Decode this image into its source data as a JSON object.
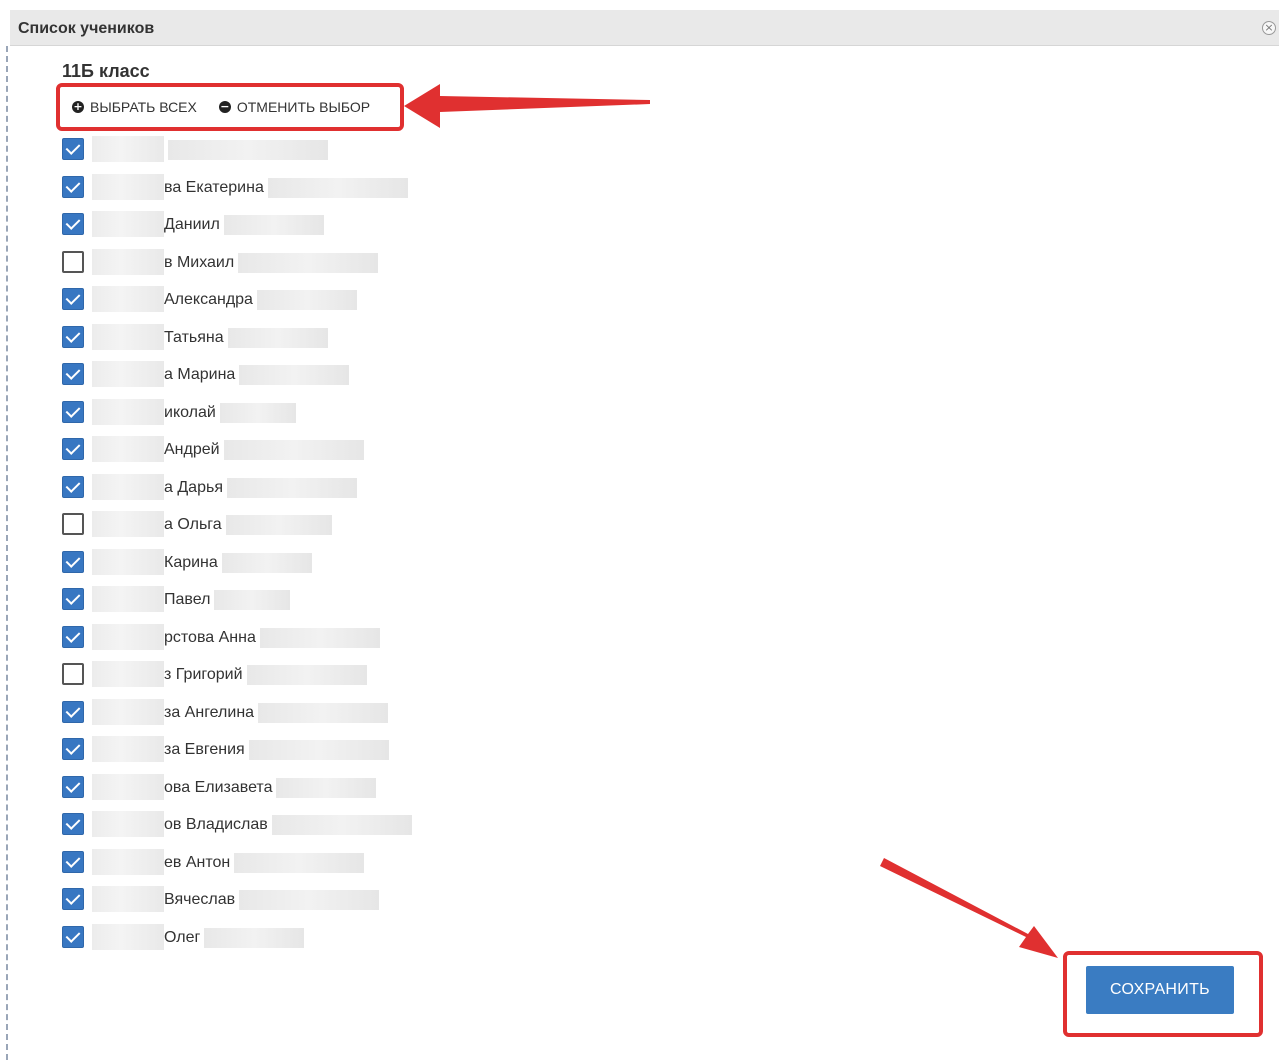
{
  "dialog": {
    "title": "Список учеников",
    "close_symbol": "×"
  },
  "class_name": "11Б класс",
  "actions": {
    "select_all": "ВЫБРАТЬ ВСЕХ",
    "select_all_icon": "plus-circle-icon",
    "deselect": "ОТМЕНИТЬ ВЫБОР",
    "deselect_icon": "minus-circle-icon"
  },
  "students": [
    {
      "name": "",
      "checked": true
    },
    {
      "name": "ва Екатерина",
      "checked": true
    },
    {
      "name": "Даниил",
      "checked": true
    },
    {
      "name": "в Михаил",
      "checked": false
    },
    {
      "name": "Александра",
      "checked": true
    },
    {
      "name": "Татьяна",
      "checked": true
    },
    {
      "name": "а Марина",
      "checked": true
    },
    {
      "name": "иколай",
      "checked": true
    },
    {
      "name": "Андрей",
      "checked": true
    },
    {
      "name": "а Дарья",
      "checked": true
    },
    {
      "name": "а Ольга",
      "checked": false
    },
    {
      "name": "Карина",
      "checked": true
    },
    {
      "name": "Павел",
      "checked": true
    },
    {
      "name": "рстова Анна",
      "checked": true
    },
    {
      "name": "з Григорий",
      "checked": false
    },
    {
      "name": "за Ангелина",
      "checked": true
    },
    {
      "name": "за Евгения",
      "checked": true
    },
    {
      "name": "ова Елизавета",
      "checked": true
    },
    {
      "name": "ов Владислав",
      "checked": true
    },
    {
      "name": "ев Антон",
      "checked": true
    },
    {
      "name": "Вячеслав",
      "checked": true
    },
    {
      "name": "Олег",
      "checked": true
    }
  ],
  "save_label": "СОХРАНИТЬ",
  "colors": {
    "accent": "#3a7cc2",
    "annotation": "#e03030",
    "checkbox_checked": "#3877c2"
  }
}
